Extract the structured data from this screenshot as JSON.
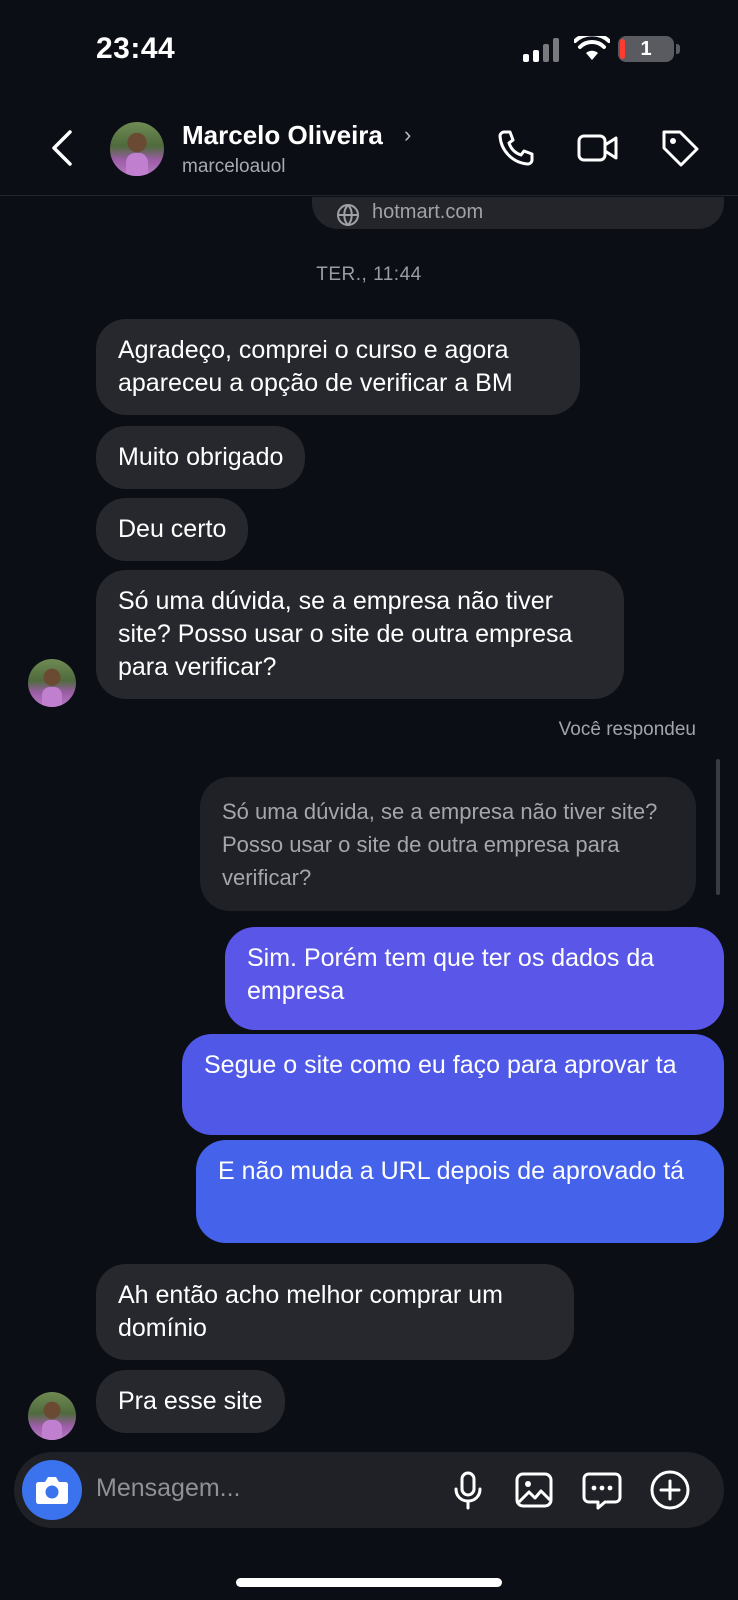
{
  "status_bar": {
    "time": "23:44",
    "battery_level": "1"
  },
  "header": {
    "contact_name": "Marcelo Oliveira",
    "username": "marceloauol",
    "icons": [
      "back-icon",
      "phone-icon",
      "video-icon",
      "tag-icon"
    ]
  },
  "chat": {
    "link_preview_domain": "hotmart.com",
    "timestamp": "TER., 11:44",
    "incoming_1": [
      "Agradeço, comprei o curso e agora apareceu a opção de verificar a BM",
      "Muito obrigado",
      "Deu certo",
      "Só uma dúvida, se a empresa não tiver site? Posso usar o site de outra empresa para verificar?"
    ],
    "reply_label": "Você respondeu",
    "quoted_text": "Só uma dúvida, se a empresa não tiver site? Posso usar o site de outra empresa para verificar?",
    "outgoing": [
      "Sim. Porém tem que ter os dados da empresa",
      "Segue o site como eu faço para aprovar ta",
      "E não muda a URL depois de aprovado tá"
    ],
    "incoming_2": [
      "Ah então acho melhor comprar um domínio",
      "Pra esse site"
    ]
  },
  "composer": {
    "placeholder": "Mensagem...",
    "icons": [
      "camera-icon",
      "microphone-icon",
      "gallery-icon",
      "sticker-icon",
      "add-icon"
    ]
  },
  "colors": {
    "background": "#0c0e15",
    "incoming_bubble": "#26282e",
    "outgoing_bubble": "#4f56e6",
    "camera_button": "#3b72ee"
  }
}
